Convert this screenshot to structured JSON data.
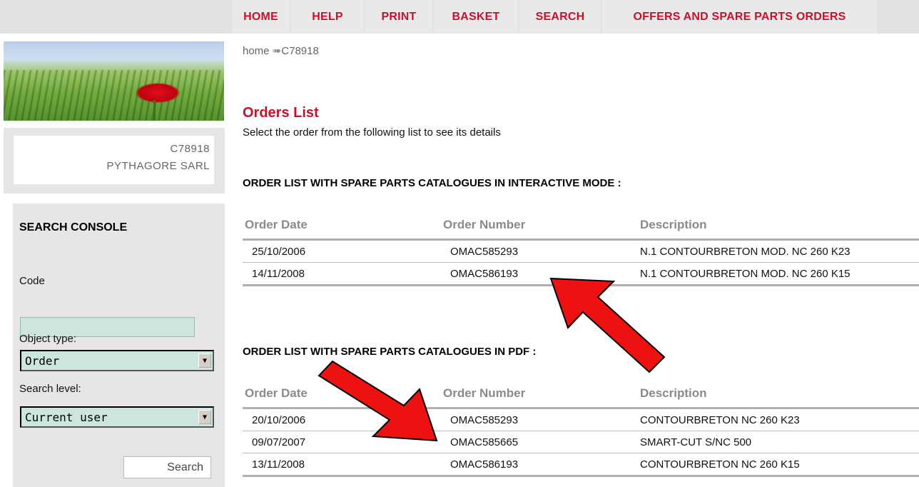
{
  "nav": {
    "home": "HOME",
    "help": "HELP",
    "print": "PRINT",
    "basket": "BASKET",
    "search": "SEARCH",
    "offers": "OFFERS AND SPARE PARTS ORDERS"
  },
  "breadcrumb": {
    "home": "home",
    "separator": "➠",
    "current": "C78918"
  },
  "user": {
    "code": "C78918",
    "company": "PYTHAGORE SARL"
  },
  "console": {
    "title": "SEARCH CONSOLE",
    "code_label": "Code",
    "code_value": "",
    "object_type_label": "Object type:",
    "object_type_value": "Order",
    "search_level_label": "Search level:",
    "search_level_value": "Current user",
    "search_button": "Search"
  },
  "page": {
    "title": "Orders List",
    "subtitle": "Select the order from the following list to see its details"
  },
  "columns": {
    "date": "Order Date",
    "number": "Order Number",
    "description": "Description"
  },
  "interactive": {
    "title": "ORDER LIST WITH SPARE PARTS CATALOGUES IN INTERACTIVE MODE :",
    "rows": [
      {
        "date": "25/10/2006",
        "number": "OMAC585293",
        "description": "N.1 CONTOURBRETON MOD. NC 260 K23"
      },
      {
        "date": "14/11/2008",
        "number": "OMAC586193",
        "description": "N.1 CONTOURBRETON MOD. NC 260 K15"
      }
    ]
  },
  "pdf": {
    "title": "ORDER LIST WITH SPARE PARTS CATALOGUES IN PDF :",
    "rows": [
      {
        "date": "20/10/2006",
        "number": "OMAC585293",
        "description": "CONTOURBRETON NC 260 K23"
      },
      {
        "date": "09/07/2007",
        "number": "OMAC585665",
        "description": "SMART-CUT S/NC 500"
      },
      {
        "date": "13/11/2008",
        "number": "OMAC586193",
        "description": "CONTOURBRETON NC 260 K15"
      }
    ]
  },
  "colors": {
    "accent": "#c8102e",
    "panel": "#e6e6e6",
    "input": "#cce6dc",
    "arrow": "#ee1111"
  }
}
